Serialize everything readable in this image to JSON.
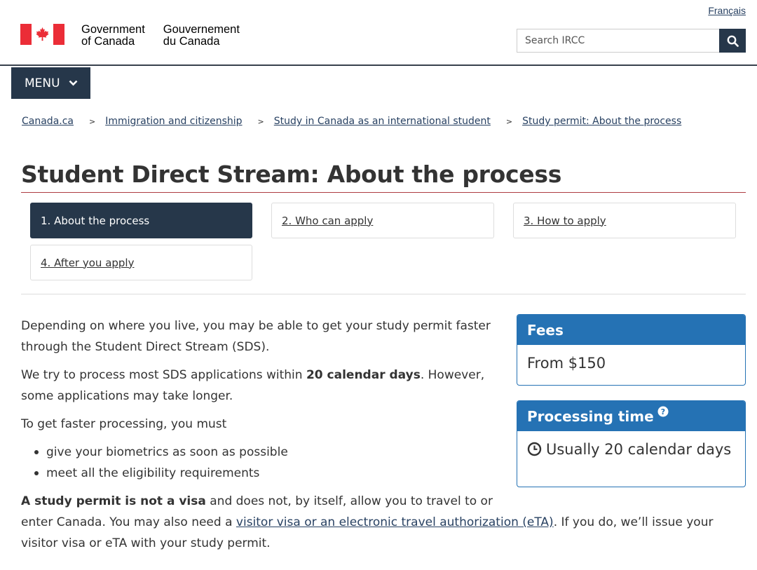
{
  "header": {
    "language_link": "Français",
    "signature_en_line1": "Government",
    "signature_en_line2": "of Canada",
    "signature_fr_line1": "Gouvernement",
    "signature_fr_line2": "du Canada",
    "search_placeholder": "Search IRCC",
    "menu_label": "MENU",
    "flag_color": "#eb2d37",
    "dark_color": "#26374a"
  },
  "breadcrumb": {
    "items": [
      {
        "label": "Canada.ca"
      },
      {
        "label": "Immigration and citizenship"
      },
      {
        "label": "Study in Canada as an international student"
      },
      {
        "label": "Study permit: About the process"
      }
    ],
    "separator": ">"
  },
  "page": {
    "title": "Student Direct Stream: About the process"
  },
  "steps": [
    {
      "label": "1. About the process",
      "active": true
    },
    {
      "label": "2. Who can apply",
      "active": false
    },
    {
      "label": "3. How to apply",
      "active": false
    },
    {
      "label": "4. After you apply",
      "active": false
    }
  ],
  "content": {
    "p1": "Depending on where you live, you may be able to get your study permit faster through the Student Direct Stream (SDS).",
    "p2_before": "We try to process most SDS applications within ",
    "p2_bold": "20 calendar days",
    "p2_after": ". However, some applications may take longer.",
    "p3": "To get faster processing, you must",
    "bullets": [
      "give your biometrics as soon as possible",
      "meet all the eligibility requirements"
    ],
    "p4_bold": "A study permit is not a visa",
    "p4_part1": " and does not, by itself, allow you to travel to or",
    "p4_part2_before": "enter Canada. You may also need a ",
    "p4_link": "visitor visa or an electronic travel authorization (eTA)",
    "p4_part2_after": ". If you do, we’ll issue your",
    "p4_part3": "visitor visa or eTA with your study permit."
  },
  "panels": {
    "fees": {
      "heading": "Fees",
      "value": "From $150"
    },
    "processing": {
      "heading": "Processing time",
      "value": "Usually 20 calendar days"
    },
    "accent_color": "#2572b4"
  }
}
